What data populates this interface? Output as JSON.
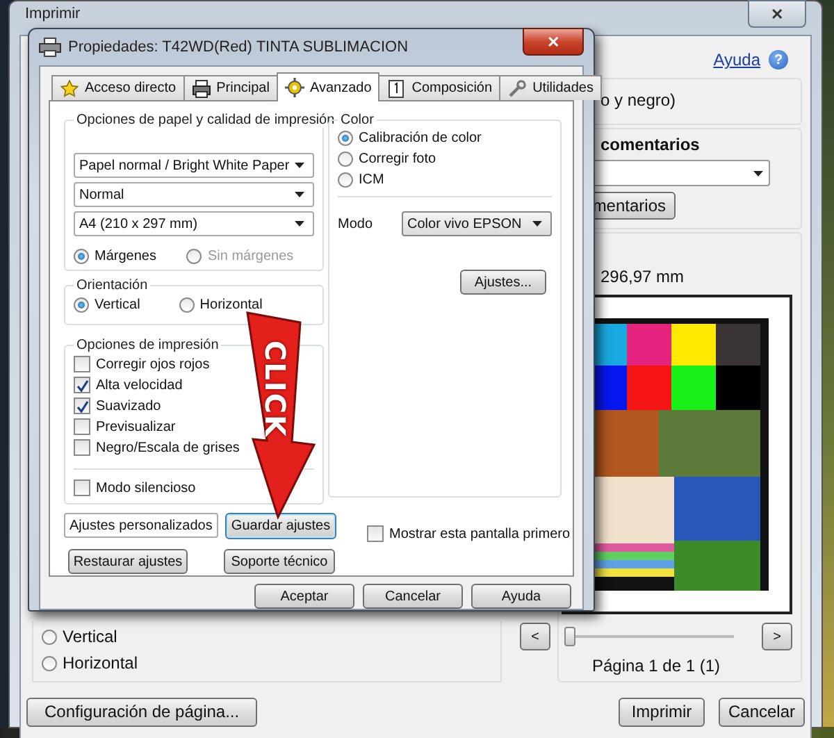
{
  "print_window": {
    "title": "Imprimir",
    "close_glyph": "✕",
    "help_link": "Ayuda",
    "help_glyph": "?",
    "color_mode_partial": "o y negro)",
    "comments_heading": "comentarios",
    "comments_button": "mentarios",
    "paper_size_partial": "296,97 mm",
    "prev_button": "<",
    "next_button": ">",
    "page_slider": {
      "level": 0
    },
    "page_label": "Página 1 de 1 (1)",
    "orientation": [
      {
        "label": "Vertical",
        "selected": false
      },
      {
        "label": "Horizontal",
        "selected": false
      }
    ],
    "page_setup_button": "Configuración de página...",
    "buttons": [
      "Imprimir",
      "Cancelar"
    ]
  },
  "properties_window": {
    "title": "Propiedades: T42WD(Red) TINTA SUBLIMACION",
    "close_glyph": "✕",
    "tabs": [
      {
        "label": "Acceso directo",
        "selected": false
      },
      {
        "label": "Principal",
        "selected": false
      },
      {
        "label": "Avanzado",
        "selected": true
      },
      {
        "label": "Composición",
        "selected": false
      },
      {
        "label": "Utilidades",
        "selected": false
      }
    ],
    "paper_group": {
      "title": "Opciones de papel y calidad de impresión",
      "dropdowns": [
        "Papel normal / Bright White Paper",
        "Normal",
        "A4 (210 x 297 mm)"
      ],
      "margins": [
        {
          "label": "Márgenes",
          "selected": true,
          "disabled": false
        },
        {
          "label": "Sin márgenes",
          "selected": false,
          "disabled": true
        }
      ]
    },
    "orientation_group": {
      "title": "Orientación",
      "options": [
        {
          "label": "Vertical",
          "selected": true
        },
        {
          "label": "Horizontal",
          "selected": false
        }
      ]
    },
    "print_options_group": {
      "title": "Opciones de impresión",
      "options": [
        {
          "label": "Corregir ojos rojos",
          "checked": false
        },
        {
          "label": "Alta velocidad",
          "checked": true
        },
        {
          "label": "Suavizado",
          "checked": true
        },
        {
          "label": "Previsualizar",
          "checked": false
        },
        {
          "label": "Negro/Escala de grises",
          "checked": false
        }
      ],
      "silent_mode": {
        "label": "Modo silencioso",
        "checked": false
      }
    },
    "preset_dropdown": "Ajustes personalizados",
    "save_button": "Guardar ajustes",
    "restore_button": "Restaurar ajustes",
    "support_button": "Soporte técnico",
    "color_group": {
      "title": "Color",
      "options": [
        {
          "label": "Calibración de color",
          "selected": true
        },
        {
          "label": "Corregir foto",
          "selected": false
        },
        {
          "label": "ICM",
          "selected": false
        }
      ],
      "mode_label": "Modo",
      "mode_value": "Color vivo EPSON",
      "settings_button": "Ajustes..."
    },
    "show_first": {
      "label": "Mostrar esta pantalla primero",
      "checked": false
    },
    "buttons": [
      "Aceptar",
      "Cancelar",
      "Ayuda"
    ]
  },
  "annotation": {
    "text": "CLICK"
  }
}
